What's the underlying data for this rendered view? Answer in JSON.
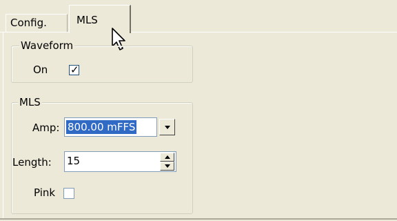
{
  "tabs": [
    {
      "label": "Config.",
      "active": false
    },
    {
      "label": "MLS",
      "active": true
    }
  ],
  "waveform_group": {
    "title": "Waveform",
    "on_label": "On",
    "on_checked": true
  },
  "mls_group": {
    "title": "MLS",
    "amp_label": "Amp:",
    "amp_value": "800.00 mFFS",
    "length_label": "Length:",
    "length_value": "15",
    "pink_label": "Pink",
    "pink_checked": false
  },
  "colors": {
    "background": "#ece9d8",
    "selection": "#316ac5"
  },
  "icons": {
    "cursor": "mouse-pointer-icon",
    "dropdown": "chevron-down-icon",
    "spinner": "spinner-arrows-icon"
  }
}
